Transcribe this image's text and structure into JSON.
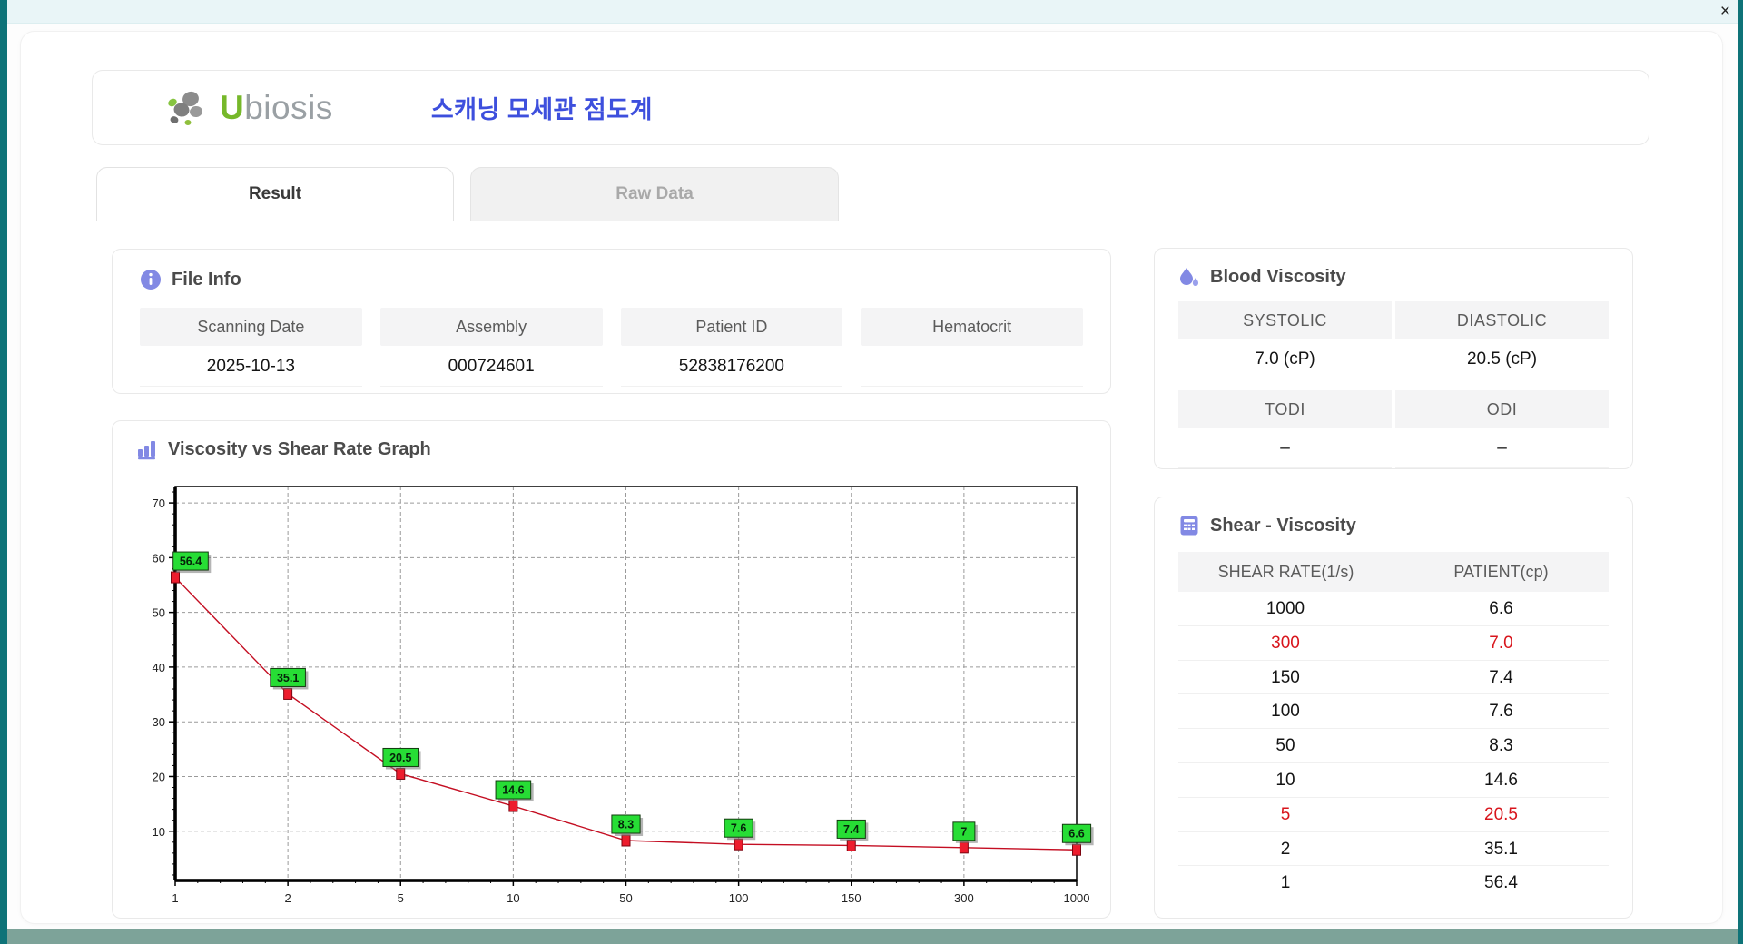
{
  "window": {
    "close_label": "×"
  },
  "header": {
    "brand_u": "U",
    "brand_rest": "biosis",
    "app_title": "스캐닝 모세관 점도계"
  },
  "tabs": {
    "result": "Result",
    "raw_data": "Raw Data"
  },
  "file_info": {
    "title": "File Info",
    "fields": [
      {
        "label": "Scanning Date",
        "value": "2025-10-13"
      },
      {
        "label": "Assembly",
        "value": "000724601"
      },
      {
        "label": "Patient ID",
        "value": "52838176200"
      },
      {
        "label": "Hematocrit",
        "value": ""
      }
    ]
  },
  "blood_viscosity": {
    "title": "Blood Viscosity",
    "rows": [
      {
        "cells": [
          {
            "label": "SYSTOLIC",
            "value": "7.0 (cP)"
          },
          {
            "label": "DIASTOLIC",
            "value": "20.5 (cP)"
          }
        ]
      },
      {
        "cells": [
          {
            "label": "TODI",
            "value": "–"
          },
          {
            "label": "ODI",
            "value": "–"
          }
        ]
      }
    ]
  },
  "shear_viscosity": {
    "title": "Shear - Viscosity",
    "columns": [
      "SHEAR RATE(1/s)",
      "PATIENT(cp)"
    ],
    "rows": [
      {
        "shear": "1000",
        "patient": "6.6",
        "highlight": false
      },
      {
        "shear": "300",
        "patient": "7.0",
        "highlight": true
      },
      {
        "shear": "150",
        "patient": "7.4",
        "highlight": false
      },
      {
        "shear": "100",
        "patient": "7.6",
        "highlight": false
      },
      {
        "shear": "50",
        "patient": "8.3",
        "highlight": false
      },
      {
        "shear": "10",
        "patient": "14.6",
        "highlight": false
      },
      {
        "shear": "5",
        "patient": "20.5",
        "highlight": true
      },
      {
        "shear": "2",
        "patient": "35.1",
        "highlight": false
      },
      {
        "shear": "1",
        "patient": "56.4",
        "highlight": false
      }
    ]
  },
  "graph_section": {
    "title": "Viscosity vs Shear Rate Graph"
  },
  "chart_data": {
    "type": "line",
    "title": "Viscosity vs Shear Rate Graph",
    "xlabel": "",
    "ylabel": "",
    "categories": [
      "1",
      "2",
      "5",
      "10",
      "50",
      "100",
      "150",
      "300",
      "1000"
    ],
    "series": [
      {
        "name": "patient",
        "values": [
          56.4,
          35.1,
          20.5,
          14.6,
          8.3,
          7.6,
          7.4,
          7.0,
          6.6
        ]
      }
    ],
    "point_labels": [
      "56.4",
      "35.1",
      "20.5",
      "14.6",
      "8.3",
      "7.6",
      "7.4",
      "7",
      "6.6"
    ],
    "y_ticks": [
      10,
      20,
      30,
      40,
      50,
      60,
      70
    ],
    "ylim": [
      1,
      73
    ],
    "grid": "dashed",
    "legend": false,
    "line_color": "#c40e22",
    "marker_color": "#ed1c2d",
    "marker_border": "#7c0410",
    "label_bg": "#27dd35",
    "label_border": "#143a10"
  },
  "colors": {
    "accent_icon": "#8289e4",
    "title_blue": "#3d4fdd",
    "brand_green": "#76b82a",
    "highlight_red": "#d8151c",
    "chrome_teal": "#0e7378",
    "bottom_bar": "#7da399"
  }
}
